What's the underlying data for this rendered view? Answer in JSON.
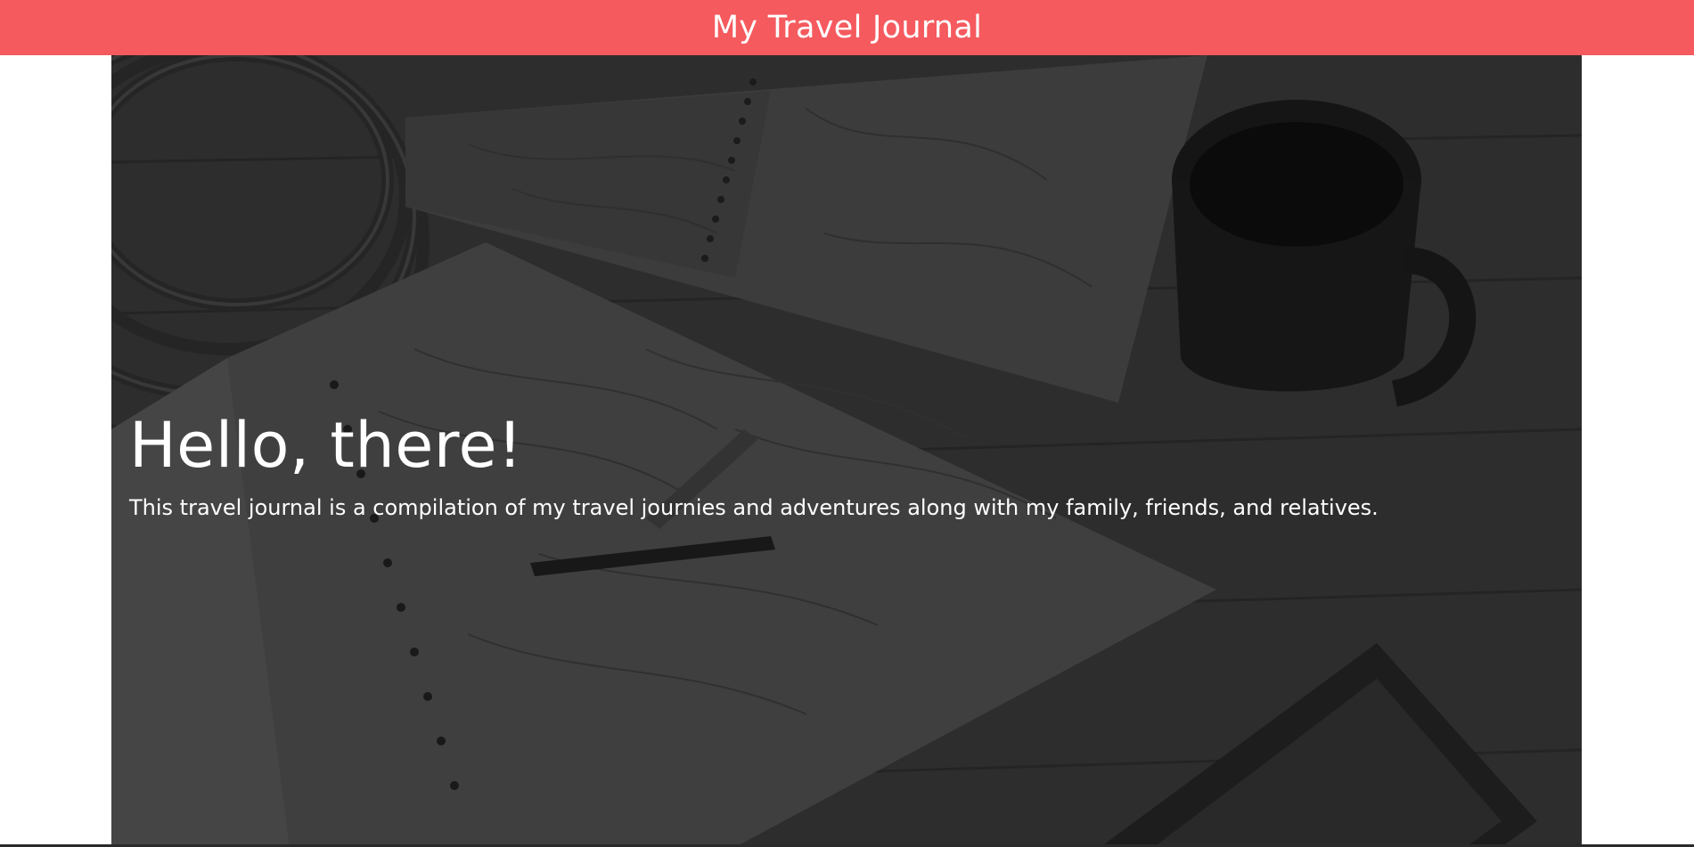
{
  "header": {
    "title": "My Travel Journal",
    "background_color": "#f55a5e"
  },
  "hero": {
    "heading": "Hello, there!",
    "paragraph": "This travel journal is a compilation of my travel journies and adventures along with my family, friends, and relatives.",
    "background_image": "dark desk scene with maps, notebook, fountain pen, rope coil, mug and phone"
  }
}
